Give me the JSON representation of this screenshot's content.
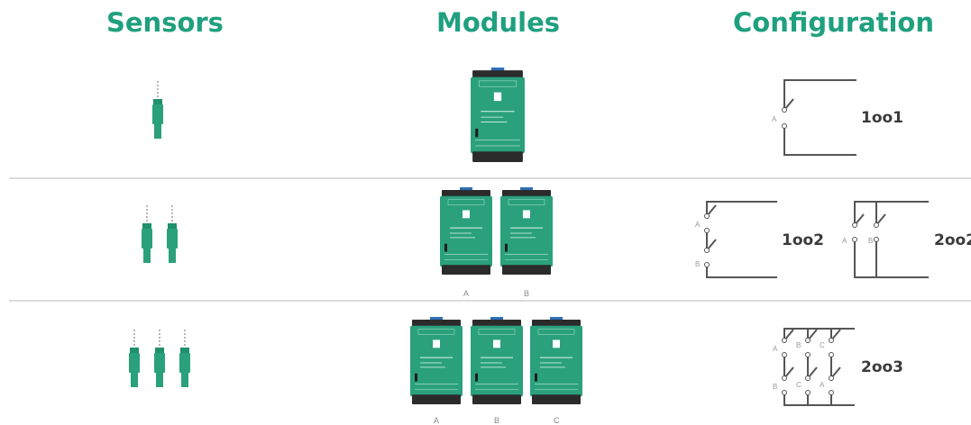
{
  "headers": {
    "sensors": "Sensors",
    "modules": "Modules",
    "configuration": "Configuration"
  },
  "rows": [
    {
      "sensors": 1,
      "modules": [
        "A"
      ],
      "module_labels_shown": false,
      "configs": [
        "1oo1"
      ]
    },
    {
      "sensors": 2,
      "modules": [
        "A",
        "B"
      ],
      "module_labels_shown": true,
      "configs": [
        "1oo2",
        "2oo2"
      ]
    },
    {
      "sensors": 3,
      "modules": [
        "A",
        "B",
        "C"
      ],
      "module_labels_shown": true,
      "configs": [
        "2oo3"
      ]
    }
  ],
  "switch_labels": {
    "a": "A",
    "b": "B",
    "c": "C"
  },
  "module_labels": {
    "a": "A",
    "b": "B",
    "c": "C"
  },
  "colors": {
    "accent": "#1fa07f",
    "module_green": "#2aa17c",
    "module_dark": "#2b2b2b",
    "line": "#555555"
  }
}
